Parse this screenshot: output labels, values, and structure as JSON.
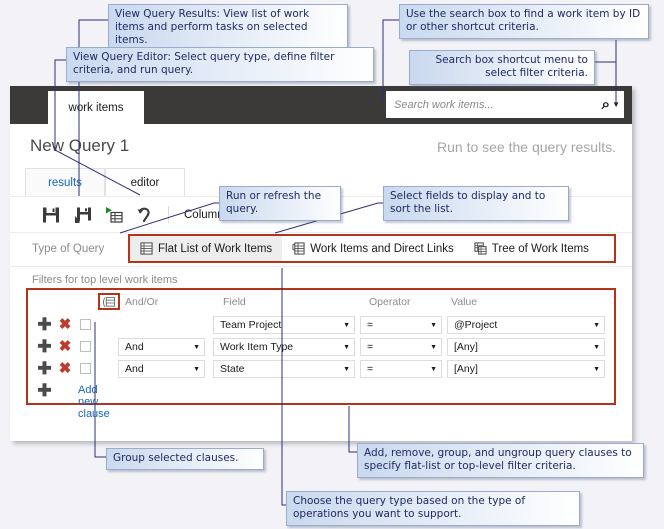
{
  "callouts": [
    {
      "id": "view-query-results",
      "text": "View Query Results: View list of work items and perform tasks on selected items."
    },
    {
      "id": "view-query-editor",
      "text": "View Query Editor: Select query type, define filter criteria, and run query."
    },
    {
      "id": "use-search-box",
      "text": "Use the search box to find a work item by ID or other shortcut criteria."
    },
    {
      "id": "search-shortcut-menu",
      "text": "Search box shortcut menu to select filter criteria."
    },
    {
      "id": "run-or-refresh",
      "text": "Run or refresh the query."
    },
    {
      "id": "select-fields",
      "text": "Select fields to display and to sort the list."
    },
    {
      "id": "group-selected-clauses",
      "text": "Group selected clauses."
    },
    {
      "id": "add-remove-group",
      "text": "Add, remove, group, and ungroup query clauses to specify flat-list or top-level filter criteria."
    },
    {
      "id": "choose-query-type",
      "text": "Choose the query type based on the type of operations you want to support."
    }
  ],
  "app": {
    "topbar": {
      "tab_label": "work items",
      "search_placeholder": "Search work items...",
      "search_icon": "search-icon",
      "search_caret_icon": "chevron-down-icon"
    },
    "page": {
      "title": "New Query 1",
      "hint": "Run to see the query results.",
      "pivots": [
        {
          "label": "results",
          "active": false
        },
        {
          "label": "editor",
          "active": true
        }
      ],
      "toolbar": {
        "icons": [
          {
            "name": "save-icon"
          },
          {
            "name": "save-as-icon"
          },
          {
            "name": "run-query-icon"
          },
          {
            "name": "undo-icon"
          }
        ],
        "column_options_label": "Column options"
      },
      "type_of_query": {
        "label": "Type of Query",
        "options": [
          {
            "label": "Flat List of Work Items",
            "icon": "flat-list-icon",
            "selected": true
          },
          {
            "label": "Work Items and Direct Links",
            "icon": "direct-links-icon",
            "selected": false
          },
          {
            "label": "Tree of Work Items",
            "icon": "tree-icon",
            "selected": false
          }
        ]
      },
      "filters": {
        "section_label": "Filters for top level work items",
        "group_icon": "group-clauses-icon",
        "headers": {
          "and_or": "And/Or",
          "field": "Field",
          "operator": "Operator",
          "value": "Value"
        },
        "rows": [
          {
            "and_or": "",
            "field": "Team Project",
            "operator": "=",
            "value": "@Project"
          },
          {
            "and_or": "And",
            "field": "Work Item Type",
            "operator": "=",
            "value": "[Any]"
          },
          {
            "and_or": "And",
            "field": "State",
            "operator": "=",
            "value": "[Any]"
          }
        ],
        "add_new_clause_label": "Add new clause",
        "add_icon": "plus-icon",
        "delete_icon": "delete-x-icon"
      }
    }
  },
  "colors": {
    "accent_red": "#b5331a",
    "topbar": "#3b3a39",
    "link": "#1466b8",
    "callout_text": "#1f2a63",
    "page_bg": "#f2f2f7"
  }
}
